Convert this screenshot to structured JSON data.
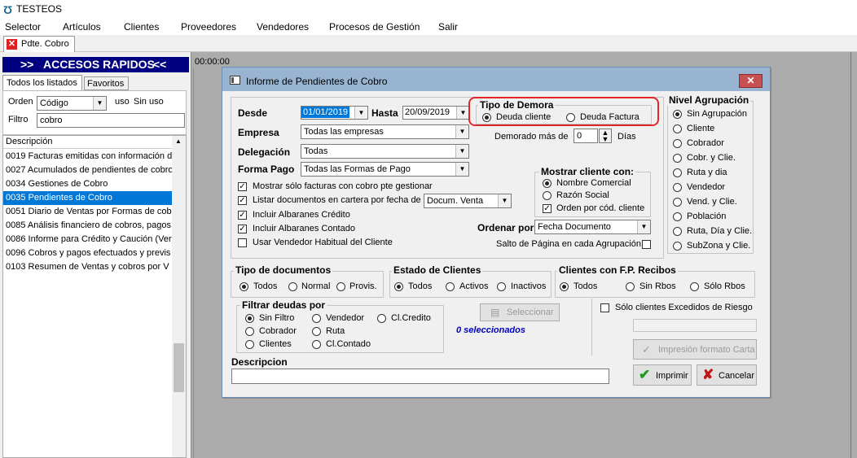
{
  "app": {
    "title": "TESTEOS"
  },
  "menu": [
    "Selector",
    "Artículos",
    "Clientes",
    "Proveedores",
    "Vendedores",
    "Procesos de Gestión",
    "Salir"
  ],
  "doc_tab": {
    "label": "Pdte. Cobro"
  },
  "left_panel": {
    "header": {
      "prev": ">>",
      "title": "ACCESOS RAPIDOS",
      "next": "<<"
    },
    "tabs": [
      "Todos los listados",
      "Favoritos"
    ],
    "orden_label": "Orden",
    "orden_value": "Código",
    "uso_label": "uso",
    "uso_value": "Sin uso",
    "filtro_label": "Filtro",
    "filtro_value": "cobro",
    "grid_header": "Descripción",
    "rows": [
      "0019 Facturas emitidas con información d",
      "0027 Acumulados de pendientes de cobro",
      "0034 Gestiones de Cobro",
      "0035 Pendientes de Cobro",
      "0051 Diario de Ventas por Formas de cob",
      "0085 Análisis financiero de cobros, pagos",
      "0086 Informe para Crédito y Caución (Ver",
      "0096 Cobros y pagos efectuados y previs",
      "0103 Resumen de Ventas y cobros por V"
    ],
    "active_row": 3
  },
  "timer": "00:00:00",
  "dialog": {
    "title": "Informe de Pendientes de Cobro",
    "close": "✕",
    "desde_label": "Desde",
    "desde_value": "01/01/2019",
    "hasta_label": "Hasta",
    "hasta_value": "20/09/2019",
    "empresa_label": "Empresa",
    "empresa_value": "Todas las empresas",
    "delegacion_label": "Delegación",
    "delegacion_value": "Todas",
    "formapago_label": "Forma Pago",
    "formapago_value": "Todas las Formas de Pago",
    "tipo_demora": {
      "title": "Tipo de Demora",
      "opt1": "Deuda cliente",
      "opt2": "Deuda Factura",
      "selected": 0
    },
    "demorado_label": "Demorado más de",
    "demorado_value": "0",
    "dias_label": "Días",
    "checks": {
      "c1": "Mostrar sólo facturas con cobro pte gestionar",
      "c2": "Listar documentos en cartera por fecha de",
      "c2_value": "Docum. Venta",
      "c3": "Incluir Albaranes Crédito",
      "c4": "Incluir Albaranes Contado",
      "c5": "Usar Vendedor Habitual del Cliente"
    },
    "mostrar_cliente": {
      "title": "Mostrar cliente con:",
      "opt1": "Nombre Comercial",
      "opt2": "Razón Social",
      "check": "Orden por cód. cliente"
    },
    "ordenar_label": "Ordenar por",
    "ordenar_value": "Fecha Documento",
    "salto_label": "Salto de Página en cada Agrupación",
    "nivel": {
      "title": "Nivel Agrupación",
      "options": [
        "Sin Agrupación",
        "Cliente",
        "Cobrador",
        "Cobr. y Clie.",
        "Ruta y dia",
        "Vendedor",
        "Vend. y Clie.",
        "Población",
        "Ruta, Día y Clie.",
        "SubZona y Clie."
      ]
    },
    "tipo_docs": {
      "title": "Tipo de documentos",
      "opts": [
        "Todos",
        "Normal",
        "Provis."
      ]
    },
    "estado": {
      "title": "Estado de Clientes",
      "opts": [
        "Todos",
        "Activos",
        "Inactivos"
      ]
    },
    "fp": {
      "title": "Clientes con F.P. Recibos",
      "opts": [
        "Todos",
        "Sin Rbos",
        "Sólo Rbos"
      ]
    },
    "filtrar": {
      "title": "Filtrar deudas por",
      "opts": [
        "Sin Filtro",
        "Vendedor",
        "Cl.Credito",
        "Cobrador",
        "Ruta",
        "Clientes",
        "Cl.Contado"
      ]
    },
    "seleccionar": "Seleccionar",
    "seleccionados": "0 seleccionados",
    "excedidos": "Sólo clientes Excedidos de Riesgo",
    "impresion_carta": "Impresión formato Carta",
    "descripcion_label": "Descripcion",
    "imprimir": "Imprimir",
    "cancelar": "Cancelar"
  }
}
